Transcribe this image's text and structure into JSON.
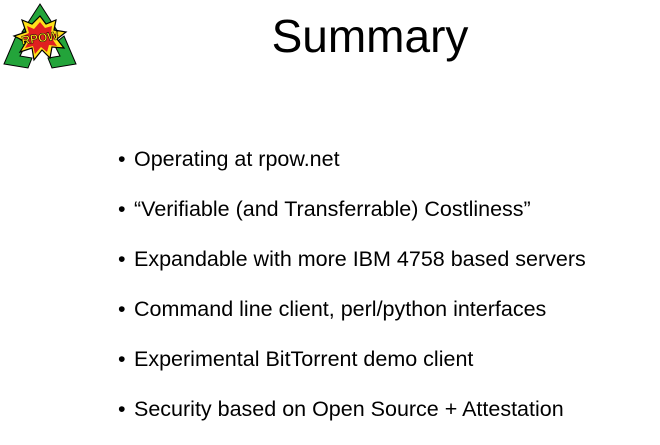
{
  "slide": {
    "logo": {
      "icon": "rpow-recycle-logo-icon",
      "text": "RPOW",
      "colors": {
        "green": "#23a43a",
        "red": "#e02020",
        "yellow": "#ffe11a",
        "black": "#000000"
      }
    },
    "title": "Summary",
    "bullets": [
      {
        "text": "Operating at rpow.net"
      },
      {
        "text": "“Verifiable (and Transferrable) Costliness”"
      },
      {
        "text": "Expandable with more IBM 4758 based servers"
      },
      {
        "text": "Command line client, perl/python interfaces"
      },
      {
        "text": "Experimental BitTorrent demo client"
      },
      {
        "text": "Security based on Open Source + Attestation"
      }
    ]
  }
}
